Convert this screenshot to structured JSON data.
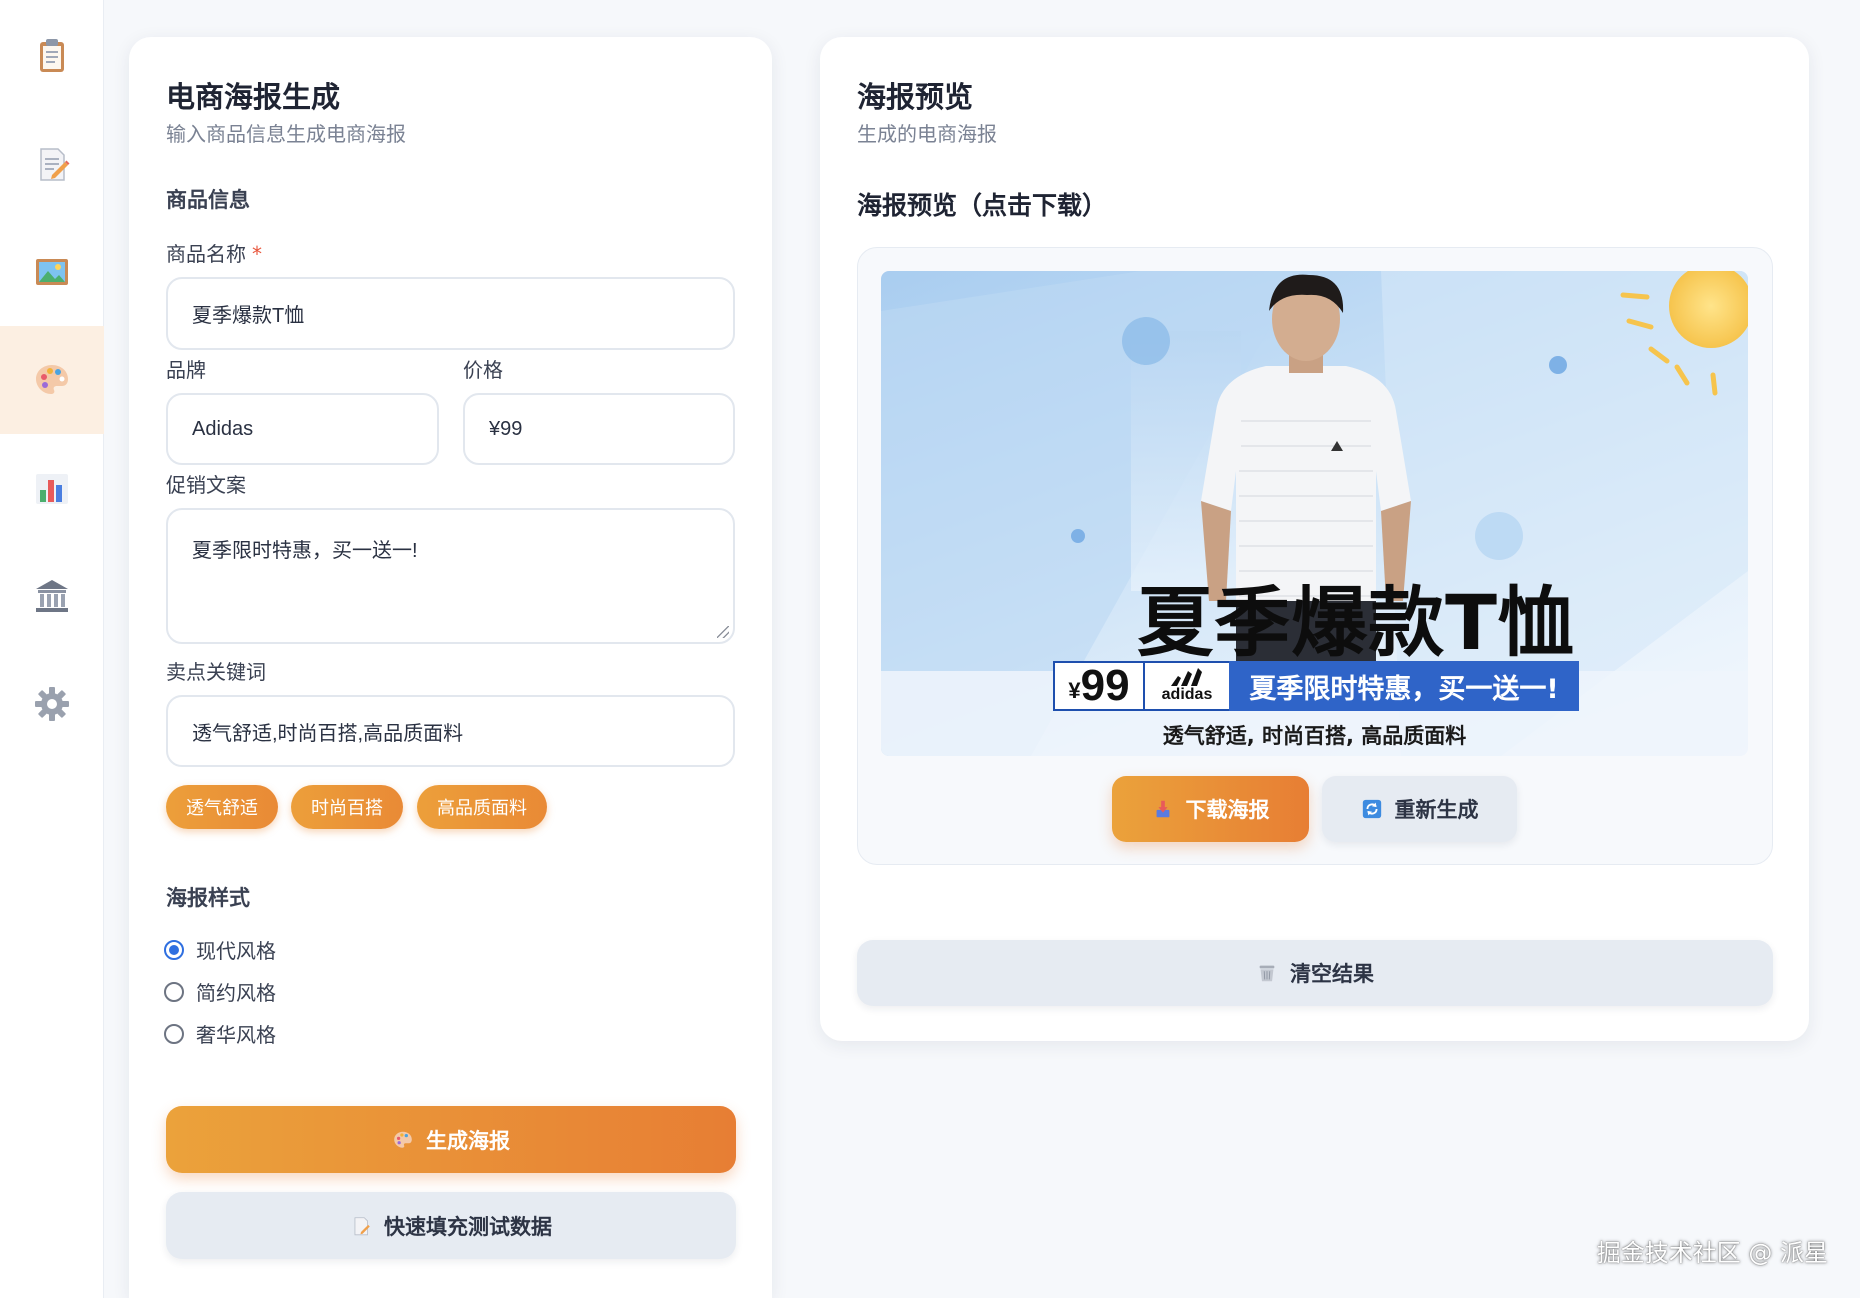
{
  "sidebar": {
    "items": [
      {
        "icon": "clipboard-icon",
        "active": false
      },
      {
        "icon": "edit-document-icon",
        "active": false
      },
      {
        "icon": "image-icon",
        "active": false
      },
      {
        "icon": "palette-icon",
        "active": true
      },
      {
        "icon": "bar-chart-icon",
        "active": false
      },
      {
        "icon": "bank-icon",
        "active": false
      },
      {
        "icon": "gear-icon",
        "active": false
      }
    ]
  },
  "form": {
    "title": "电商海报生成",
    "subtitle": "输入商品信息生成电商海报",
    "section_product": "商品信息",
    "name_label": "商品名称",
    "name_required": "*",
    "name_value": "夏季爆款T恤",
    "brand_label": "品牌",
    "brand_value": "Adidas",
    "price_label": "价格",
    "price_value": "¥99",
    "promo_label": "促销文案",
    "promo_value": "夏季限时特惠，买一送一!",
    "keywords_label": "卖点关键词",
    "keywords_value": "透气舒适,时尚百搭,高品质面料",
    "tags": [
      "透气舒适",
      "时尚百搭",
      "高品质面料"
    ],
    "style_label": "海报样式",
    "styles": [
      {
        "label": "现代风格",
        "checked": true
      },
      {
        "label": "简约风格",
        "checked": false
      },
      {
        "label": "奢华风格",
        "checked": false
      }
    ],
    "generate_label": "生成海报",
    "fill_test_label": "快速填充测试数据"
  },
  "preview": {
    "title": "海报预览",
    "subtitle": "生成的电商海报",
    "heading": "海报预览（点击下载）",
    "poster": {
      "headline": "夏季爆款T恤",
      "price_currency": "¥",
      "price_number": "99",
      "brand_wordmark": "adidas",
      "promo": "夏季限时特惠，买一送一!",
      "keywords": "透气舒适, 时尚百搭, 高品质面料"
    },
    "download_label": "下载海报",
    "regenerate_label": "重新生成",
    "clear_label": "清空结果"
  },
  "watermark": "掘金技术社区 @ 派星",
  "colors": {
    "accent_orange": "#e98a36",
    "radio_blue": "#2f6fe0",
    "promo_blue": "#2f64c8",
    "active_sidebar": "#fcefe2"
  }
}
